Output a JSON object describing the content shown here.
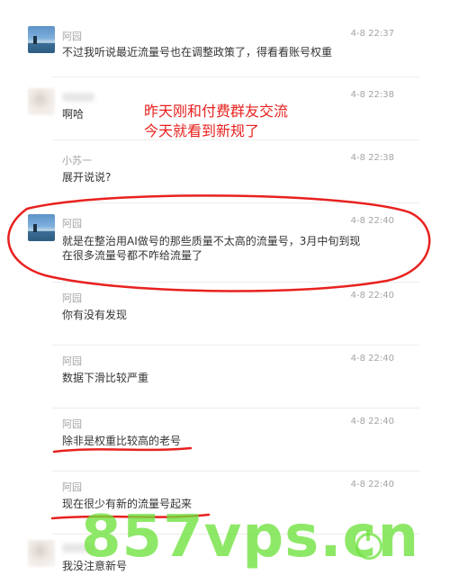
{
  "annotation": {
    "line1": "昨天刚和付费群友交流",
    "line2": "今天就看到新规了"
  },
  "watermark": "857vps.cn",
  "messages": [
    {
      "name": "阿园",
      "time": "4-8 22:37",
      "text": "不过我听说最近流量号也在调整政策了，得看看账号权重",
      "avatar": "landscape-avatar"
    },
    {
      "name": "",
      "time": "4-8 22:38",
      "text": "啊哈",
      "avatar": "blurred-avatar"
    },
    {
      "name": "小苏一",
      "time": "4-8 22:38",
      "text": "展开说说?",
      "avatar": "none"
    },
    {
      "name": "阿园",
      "time": "4-8 22:40",
      "text_line1": "就是在整治用AI做号的那些质量不太高的流量号，3月中旬到现",
      "text_line2": "在很多流量号都不咋给流量了",
      "avatar": "landscape-avatar"
    },
    {
      "name": "阿园",
      "time": "4-8 22:40",
      "text": "你有没有发现",
      "avatar": "none"
    },
    {
      "name": "阿园",
      "time": "4-8 22:40",
      "text": "数据下滑比较严重",
      "avatar": "none"
    },
    {
      "name": "阿园",
      "time": "4-8 22:40",
      "text": "除非是权重比较高的老号",
      "avatar": "none"
    },
    {
      "name": "阿园",
      "time": "4-8 22:40",
      "text": "现在很少有新的流量号起来",
      "avatar": "none"
    },
    {
      "name": "",
      "time": "",
      "text": "我没注意新号",
      "avatar": "blurred-avatar"
    }
  ],
  "colors": {
    "annotation": "#e8211e",
    "watermark": "#6ee23c",
    "meta": "#a4a4a4",
    "text": "#333333"
  }
}
